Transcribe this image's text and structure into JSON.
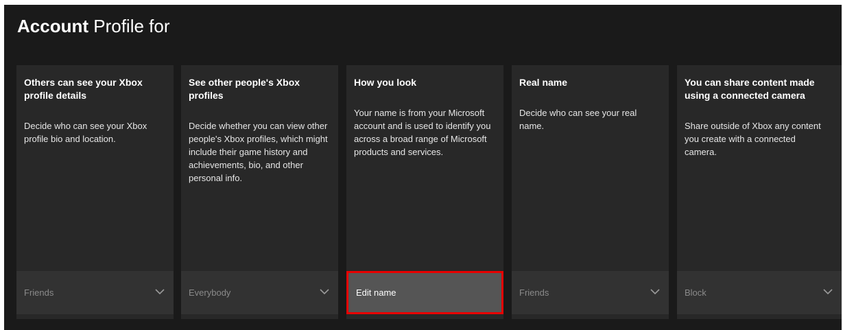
{
  "header": {
    "title_bold": "Account",
    "title_rest": "Profile for"
  },
  "panels": [
    {
      "title": "Others can see your Xbox profile details",
      "description": "Decide who can see your Xbox profile bio and location.",
      "control_value": "Friends",
      "control_icon": "chevron-down-icon"
    },
    {
      "title": "See other people's Xbox profiles",
      "description": "Decide whether you can view other people's Xbox profiles, which might include their game history and achievements, bio, and other personal info.",
      "control_value": "Everybody",
      "control_icon": "chevron-down-icon"
    },
    {
      "title": "How you look",
      "description": "Your name is from your Microsoft account and is used to identify you across a broad range of Microsoft products and services.",
      "control_value": "Edit name",
      "highlight_color": "#e80000"
    },
    {
      "title": "Real name",
      "description": "Decide who can see your real name.",
      "control_value": "Friends",
      "control_icon": "chevron-down-icon"
    },
    {
      "title": "You can share content made using a connected camera",
      "description": "Share outside of Xbox any content you create with a connected camera.",
      "control_value": "Block",
      "control_icon": "chevron-down-icon"
    }
  ],
  "colors": {
    "background": "#1a1a1a",
    "panel": "#282828",
    "control": "#323232",
    "highlight": "#e80000"
  }
}
